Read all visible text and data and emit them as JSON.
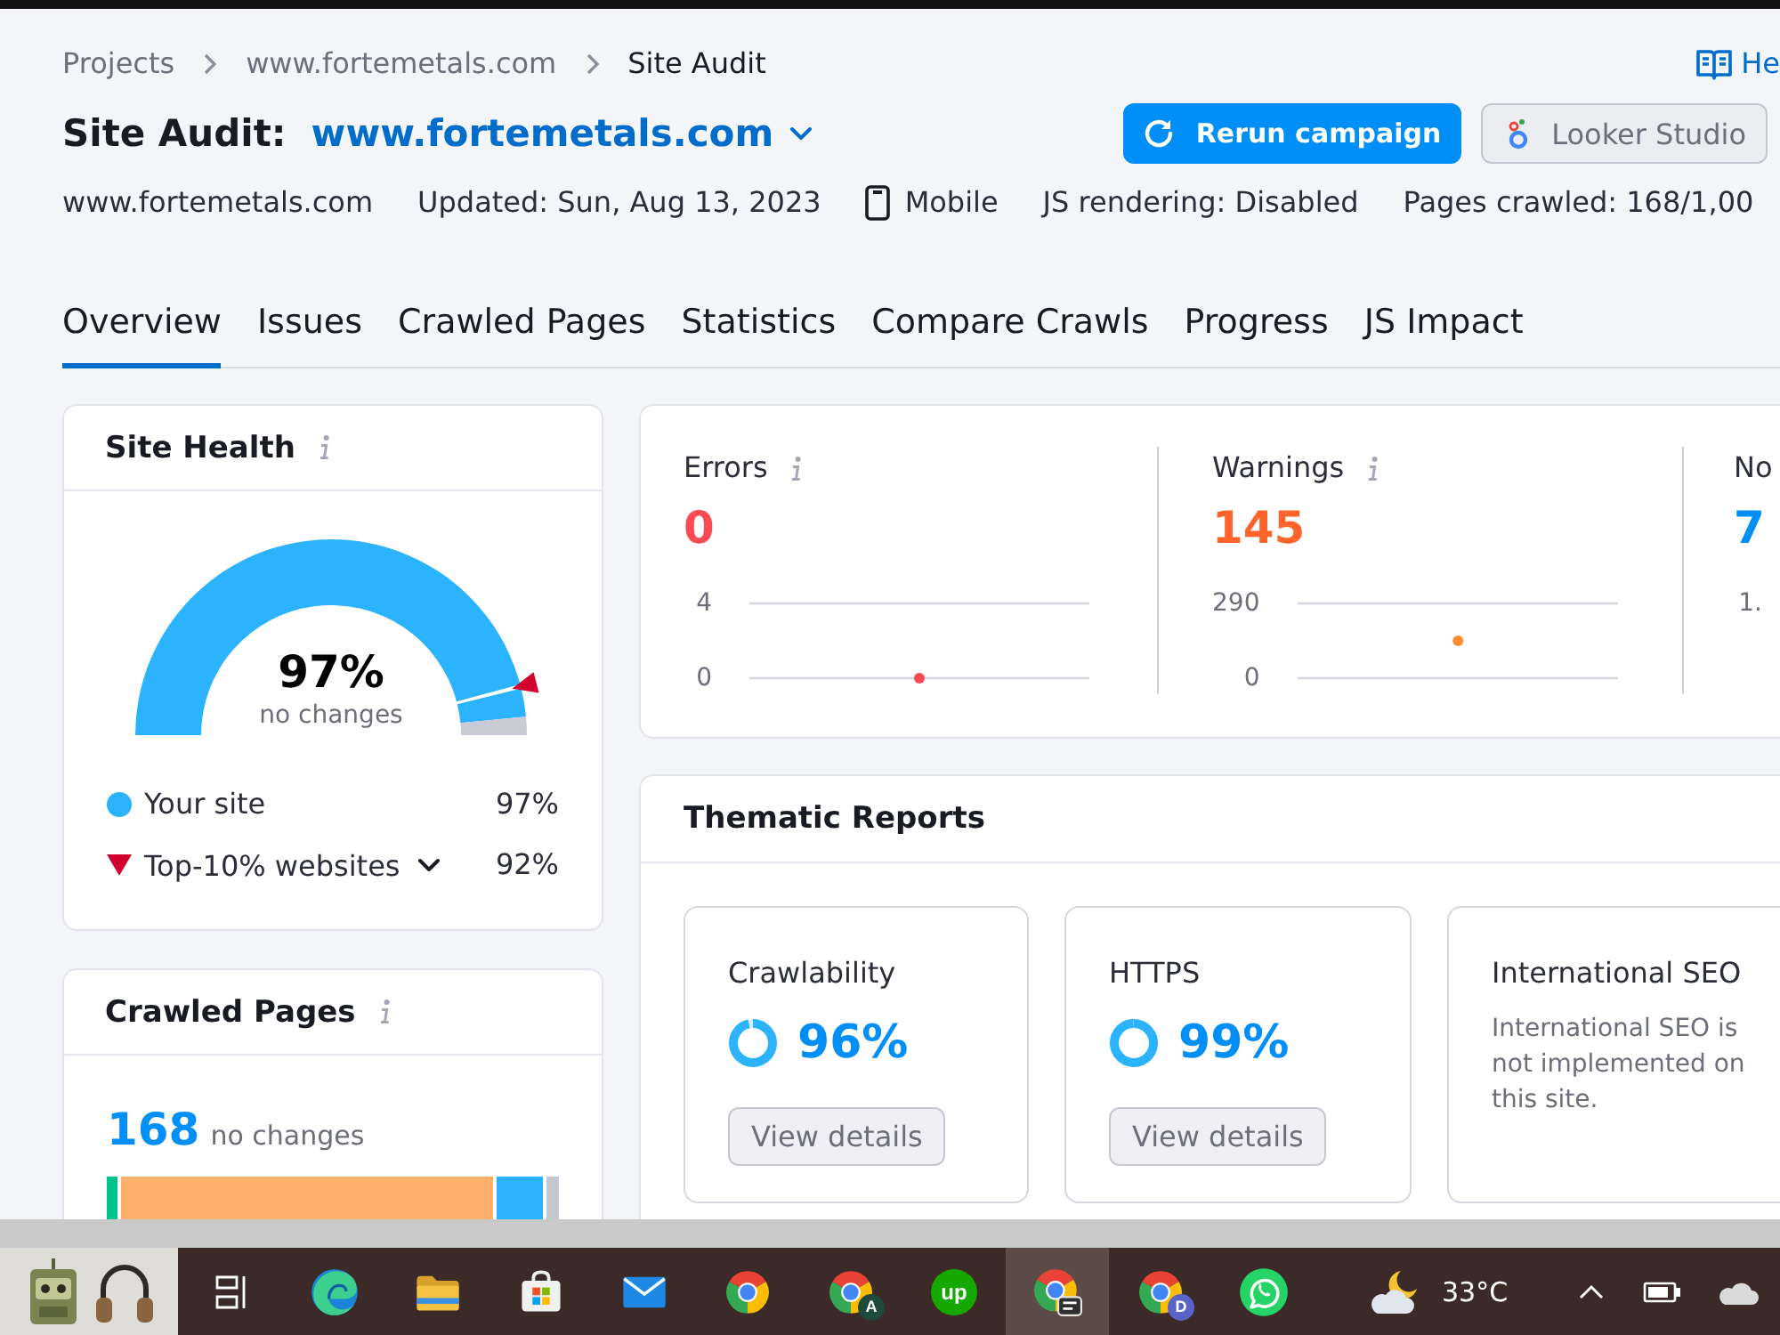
{
  "breadcrumbs": [
    {
      "label": "Projects"
    },
    {
      "label": "www.fortemetals.com"
    },
    {
      "label": "Site Audit"
    }
  ],
  "help_link": {
    "label": "He"
  },
  "title": {
    "label": "Site Audit:",
    "domain": "www.fortemetals.com"
  },
  "actions": [
    {
      "kind": "primary",
      "label": "Rerun campaign"
    },
    {
      "kind": "secondary",
      "label": "Looker Studio"
    }
  ],
  "meta": [
    {
      "kind": "text",
      "text": "www.fortemetals.com"
    },
    {
      "kind": "text",
      "text": "Updated: Sun, Aug 13, 2023"
    },
    {
      "kind": "device",
      "text": "Mobile"
    },
    {
      "kind": "text",
      "text": "JS rendering: Disabled"
    },
    {
      "kind": "text",
      "text": "Pages crawled: 168/1,00"
    }
  ],
  "tabs": [
    {
      "label": "Overview",
      "selected": true
    },
    {
      "label": "Issues",
      "selected": false
    },
    {
      "label": "Crawled Pages",
      "selected": false
    },
    {
      "label": "Statistics",
      "selected": false
    },
    {
      "label": "Compare Crawls",
      "selected": false
    },
    {
      "label": "Progress",
      "selected": false
    },
    {
      "label": "JS Impact",
      "selected": false
    }
  ],
  "site_health": {
    "title": "Site Health",
    "info": true,
    "score": "97%",
    "change": "no changes",
    "legend": [
      {
        "kind": "dot",
        "label": "Your site",
        "value": "97%",
        "color": "#2bb3ff",
        "level": 0.97
      },
      {
        "kind": "triangle",
        "label": "Top-10% websites",
        "value": "92%",
        "color": "#d1002f",
        "level": 0.92,
        "expanded": false
      }
    ]
  },
  "crawled_pages": {
    "title": "Crawled Pages",
    "info": true,
    "count": "168",
    "change": "no changes"
  },
  "issues": [
    {
      "label": "Errors",
      "info": true,
      "count": "0",
      "color": "#ff4953",
      "chart_data": {
        "type": "scatter",
        "ylim": [
          0,
          4
        ],
        "yticks": [
          0,
          4
        ],
        "series": [
          {
            "color": "#ff4953",
            "values": [
              0
            ]
          }
        ]
      }
    },
    {
      "label": "Warnings",
      "info": true,
      "count": "145",
      "color": "#ff642d",
      "chart_data": {
        "type": "scatter",
        "ylim": [
          0,
          290
        ],
        "yticks": [
          0,
          290
        ],
        "series": [
          {
            "color": "#ff8c2e",
            "values": [
              145
            ]
          }
        ]
      }
    },
    {
      "label": "No",
      "count": "7",
      "color": "#008ff8",
      "tick": "1."
    }
  ],
  "thematic_reports": {
    "title": "Thematic Reports",
    "reports": [
      {
        "kind": "score",
        "name": "Crawlability",
        "score": "96%",
        "level": 0.96,
        "action": "View details"
      },
      {
        "kind": "score",
        "name": "HTTPS",
        "score": "99%",
        "level": 0.99,
        "action": "View details"
      },
      {
        "kind": "message",
        "name": "International SEO",
        "message": "International SEO is not implemented on this site."
      }
    ]
  },
  "taskbar": {
    "pinned": [
      {
        "kind": "robot"
      },
      {
        "kind": "headphones"
      }
    ],
    "apps": [
      {
        "kind": "taskview",
        "selected": false
      },
      {
        "kind": "edge",
        "selected": false
      },
      {
        "kind": "folder",
        "selected": false
      },
      {
        "kind": "store",
        "selected": false
      },
      {
        "kind": "mail",
        "selected": false
      },
      {
        "kind": "chrome",
        "selected": false
      },
      {
        "kind": "chrome",
        "badge": "A",
        "color": "#1d4a3c",
        "selected": false
      },
      {
        "kind": "upwork",
        "logo": "up",
        "selected": false
      },
      {
        "kind": "chromecast",
        "selected": true
      },
      {
        "kind": "chrome",
        "badge": "D",
        "color": "#5a63c8",
        "selected": false
      },
      {
        "kind": "whatsapp",
        "selected": false
      }
    ],
    "weather": {
      "temperature": "33°C"
    },
    "tray": [
      {
        "kind": "chevron"
      },
      {
        "kind": "battery"
      },
      {
        "kind": "cloud"
      }
    ]
  }
}
